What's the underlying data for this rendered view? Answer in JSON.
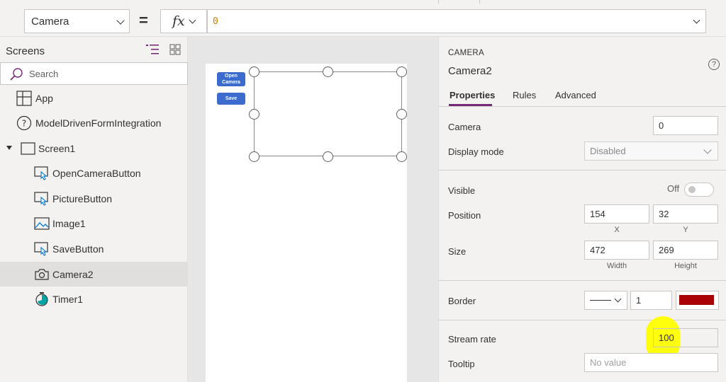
{
  "formula_bar": {
    "property": "Camera",
    "equals": "=",
    "fx_label": "fx",
    "formula": "0"
  },
  "tree": {
    "title": "Screens",
    "search_placeholder": "Search",
    "items": [
      {
        "label": "App",
        "icon": "app-icon"
      },
      {
        "label": "ModelDrivenFormIntegration",
        "icon": "help-circle-icon"
      },
      {
        "label": "Screen1",
        "icon": "screen-icon"
      },
      {
        "label": "OpenCameraButton",
        "icon": "button-icon"
      },
      {
        "label": "PictureButton",
        "icon": "button-icon"
      },
      {
        "label": "Image1",
        "icon": "image-icon"
      },
      {
        "label": "SaveButton",
        "icon": "button-icon"
      },
      {
        "label": "Camera2",
        "icon": "camera-icon",
        "selected": true
      },
      {
        "label": "Timer1",
        "icon": "timer-icon"
      }
    ]
  },
  "canvas": {
    "open_camera_label": "Open Camera",
    "save_label": "Save"
  },
  "properties": {
    "control_type": "CAMERA",
    "control_name": "Camera2",
    "tabs": [
      "Properties",
      "Rules",
      "Advanced"
    ],
    "camera_label": "Camera",
    "camera_value": "0",
    "display_mode_label": "Display mode",
    "display_mode_value": "Disabled",
    "visible_label": "Visible",
    "visible_value": "Off",
    "position_label": "Position",
    "position_x": "154",
    "position_y": "32",
    "x_label": "X",
    "y_label": "Y",
    "size_label": "Size",
    "width": "472",
    "height": "269",
    "width_label": "Width",
    "height_label": "Height",
    "border_label": "Border",
    "border_thickness": "1",
    "border_color": "#a80000",
    "stream_rate_label": "Stream rate",
    "stream_rate_value": "100",
    "tooltip_label": "Tooltip",
    "tooltip_placeholder": "No value"
  },
  "colors": {
    "accent": "#742774",
    "button_blue": "#3b6bcc",
    "highlight": "#ffff00"
  }
}
